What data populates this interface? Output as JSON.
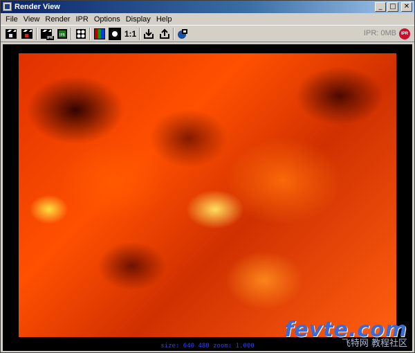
{
  "window": {
    "title": "Render View"
  },
  "title_buttons": {
    "minimize": "_",
    "maximize": "□",
    "close": "✕"
  },
  "menu": [
    "File",
    "View",
    "Render",
    "IPR",
    "Options",
    "Display",
    "Help"
  ],
  "toolbar": {
    "ipr_badge": "IPR",
    "ratio": "1:1",
    "ipr_memory": "IPR: 0MB",
    "ipr_stop": "IPR",
    "icons": [
      "redo-render-icon",
      "render-region-icon",
      "ipr-render-icon",
      "refresh-ipr-icon",
      "render-settings-icon",
      "rgb-channels-icon",
      "alpha-channel-icon",
      "real-size-icon",
      "keep-image-icon",
      "remove-image-icon",
      "render-globals-icon"
    ]
  },
  "status": {
    "text": "size:  640  480 zoom: 1.000"
  },
  "watermark": {
    "logo": "fevte.com",
    "sub": "飞特网 教程社区"
  }
}
